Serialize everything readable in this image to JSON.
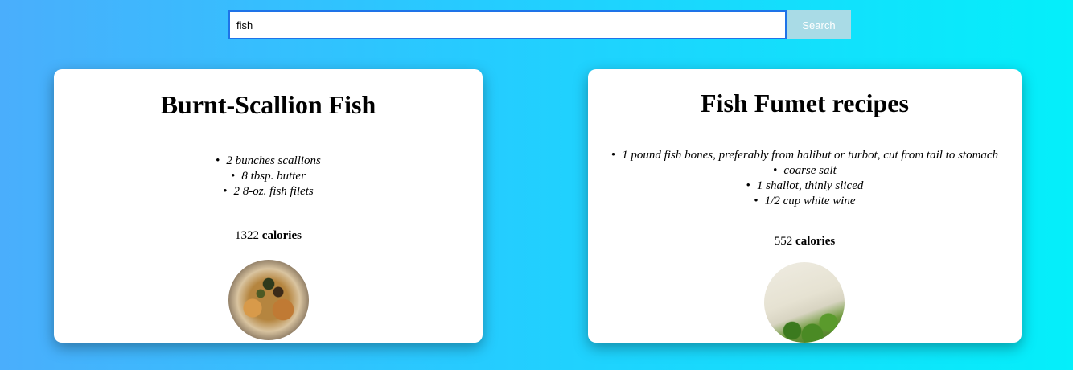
{
  "search": {
    "value": "fish",
    "button_label": "Search"
  },
  "recipes": [
    {
      "title": "Burnt-Scallion Fish",
      "ingredients": [
        "2 bunches scallions",
        "8 tbsp. butter",
        "2 8-oz. fish filets"
      ],
      "calories_value": "1322",
      "calories_label": "calories"
    },
    {
      "title": "Fish Fumet recipes",
      "ingredients": [
        "1 pound fish bones, preferably from halibut or turbot, cut from tail to stomach",
        "coarse salt",
        "1 shallot, thinly sliced",
        "1/2 cup white wine"
      ],
      "calories_value": "552",
      "calories_label": "calories"
    }
  ],
  "colors": {
    "background_start": "#4aaefc",
    "background_end": "#04effa",
    "search_border": "#1e73e8",
    "search_button": "#a9dbe6"
  }
}
